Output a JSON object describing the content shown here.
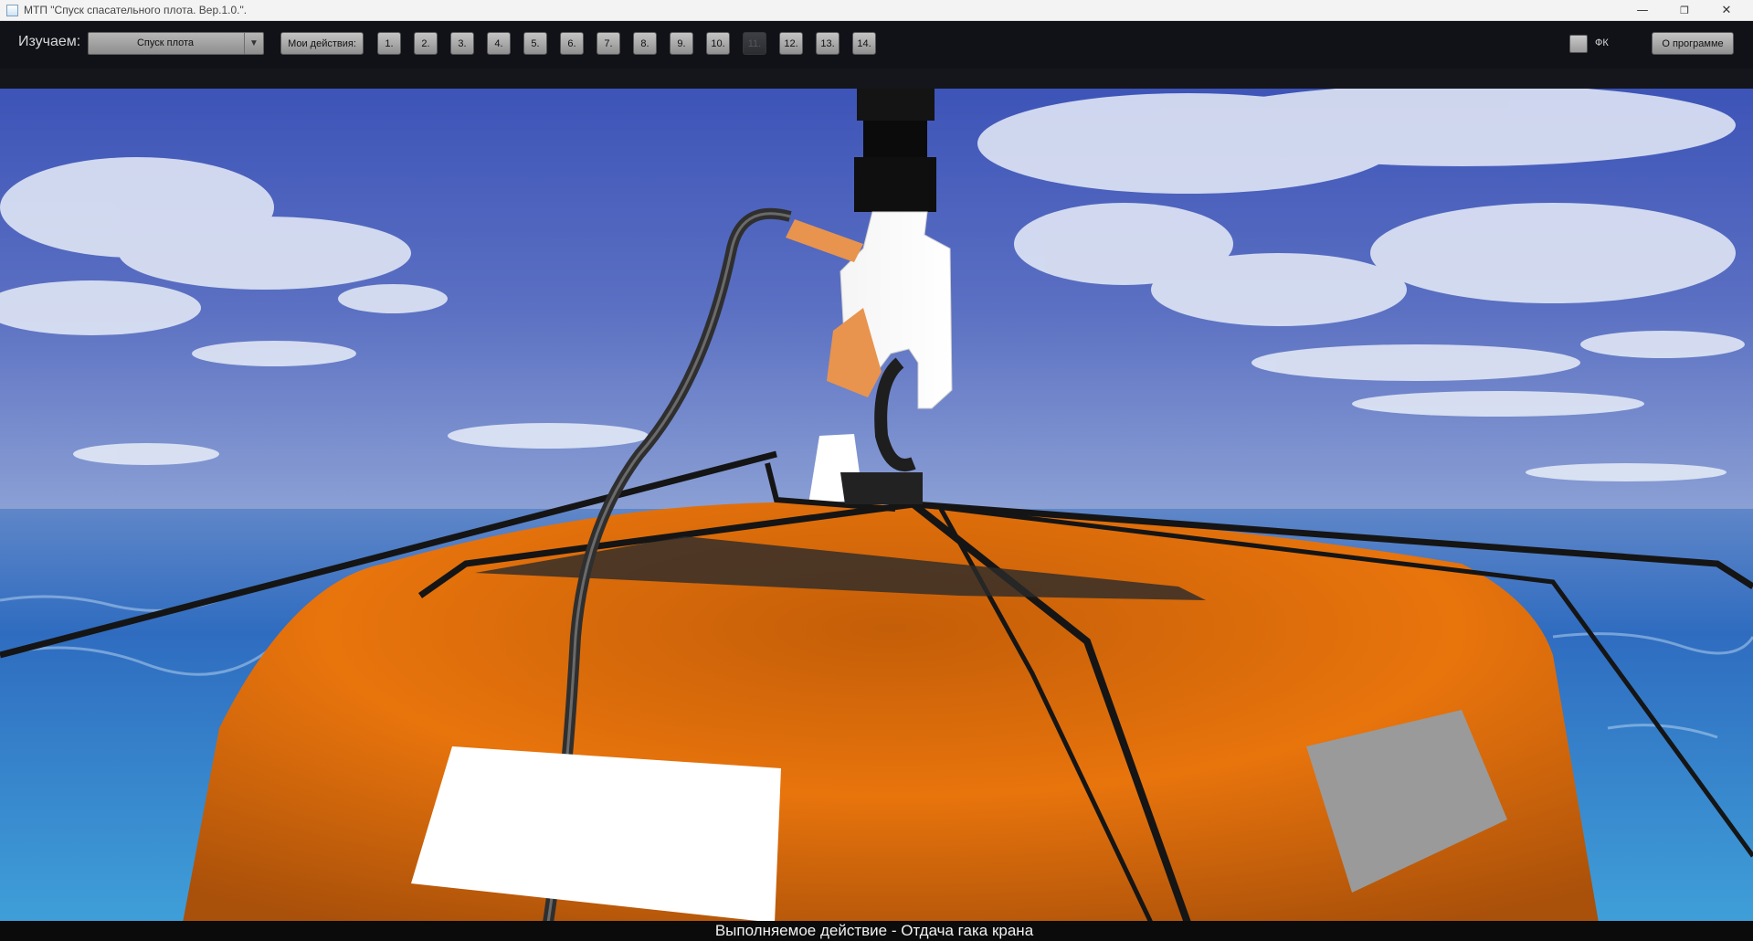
{
  "window": {
    "title": "МТП \"Спуск спасательного плота. Вер.1.0.\"."
  },
  "toolbar": {
    "learn_label": "Изучаем:",
    "mode_selected": "Спуск плота",
    "my_actions_label": "Мои действия:",
    "steps": [
      "1.",
      "2.",
      "3.",
      "4.",
      "5.",
      "6.",
      "7.",
      "8.",
      "9.",
      "10.",
      "11.",
      "12.",
      "13.",
      "14."
    ],
    "disabled_step": "11.",
    "fk_label": "ФК",
    "fk_checked": false,
    "about_label": "О программе"
  },
  "status": {
    "text": "Выполняемое действие - Отдача гака крана"
  },
  "colors": {
    "raft_orange": "#e8740c",
    "sky_blue": "#5a6fc0",
    "sea_blue": "#2a63b6"
  }
}
